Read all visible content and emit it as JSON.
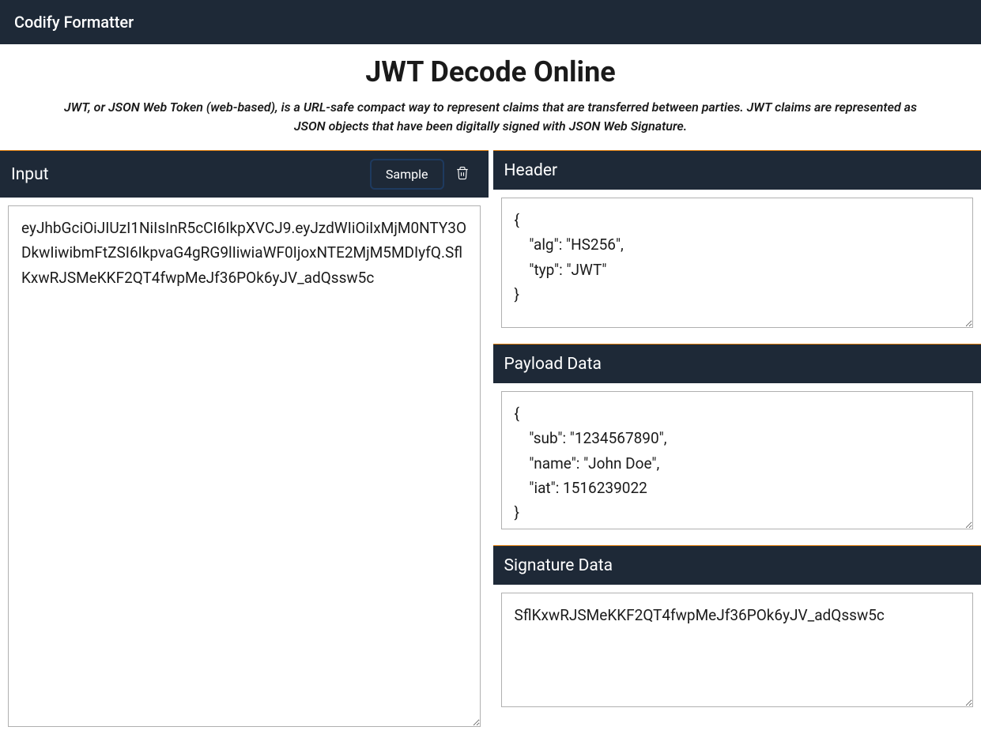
{
  "topbar": {
    "brand": "Codify Formatter"
  },
  "header": {
    "title": "JWT Decode Online",
    "description": "JWT, or JSON Web Token (web-based), is a URL-safe compact way to represent claims that are transferred between parties. JWT claims are represented as JSON objects that have been digitally signed with JSON Web Signature."
  },
  "input": {
    "title": "Input",
    "sample_label": "Sample",
    "value": "eyJhbGciOiJIUzI1NiIsInR5cCI6IkpXVCJ9.eyJzdWIiOiIxMjM0NTY3ODkwIiwibmFtZSI6IkpvaG4gRG9lIiwiaWF0IjoxNTE2MjM5MDIyfQ.SflKxwRJSMeKKF2QT4fwpMeJf36POk6yJV_adQssw5c"
  },
  "output": {
    "header": {
      "title": "Header",
      "value": "{\n    \"alg\": \"HS256\",\n    \"typ\": \"JWT\"\n}"
    },
    "payload": {
      "title": "Payload Data",
      "value": "{\n    \"sub\": \"1234567890\",\n    \"name\": \"John Doe\",\n    \"iat\": 1516239022\n}"
    },
    "signature": {
      "title": "Signature Data",
      "value": "SflKxwRJSMeKKF2QT4fwpMeJf36POk6yJV_adQssw5c"
    }
  }
}
